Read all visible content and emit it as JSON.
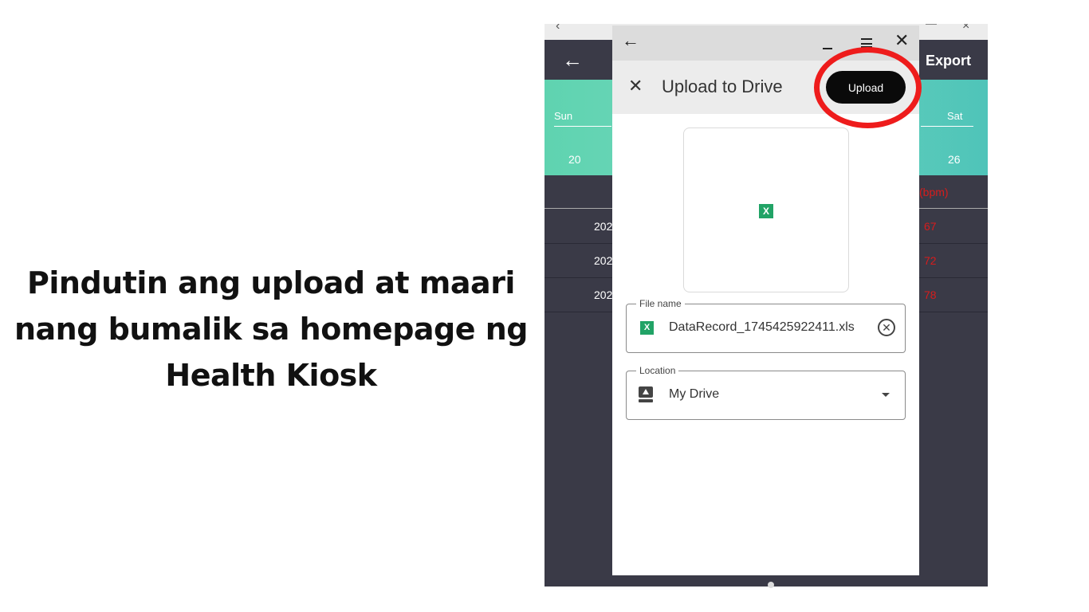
{
  "caption": {
    "text": "Pindutin ang upload at  maari nang bumalik sa homepage ng Health Kiosk"
  },
  "background_app": {
    "header": {
      "export_label": "Export"
    },
    "calendar": {
      "day_first": "Sun",
      "day_last": "Sat",
      "date_first": "20",
      "date_last": "26"
    },
    "column_header": {
      "bpm": "(bpm)"
    },
    "rows": [
      {
        "date": "202",
        "value": "67"
      },
      {
        "date": "202",
        "value": "72"
      },
      {
        "date": "202",
        "value": "78"
      }
    ],
    "value_color": "#d71c1c",
    "header_color": "#3a3a47"
  },
  "dialog": {
    "title": "Upload to Drive",
    "upload_button": "Upload",
    "file_icon_glyph": "X",
    "file_name": {
      "label": "File name",
      "value": "DataRecord_1745425922411.xls"
    },
    "location": {
      "label": "Location",
      "value": "My Drive"
    }
  },
  "icons": {
    "back": "left-arrow-icon",
    "close": "close-icon",
    "minimize": "minimize-icon",
    "maximize": "maximize-icon",
    "excel": "excel-file-icon",
    "clear": "clear-circle-icon",
    "drive": "drive-icon",
    "dropdown": "dropdown-arrow-icon"
  },
  "highlight_color": "#ee1c1c"
}
